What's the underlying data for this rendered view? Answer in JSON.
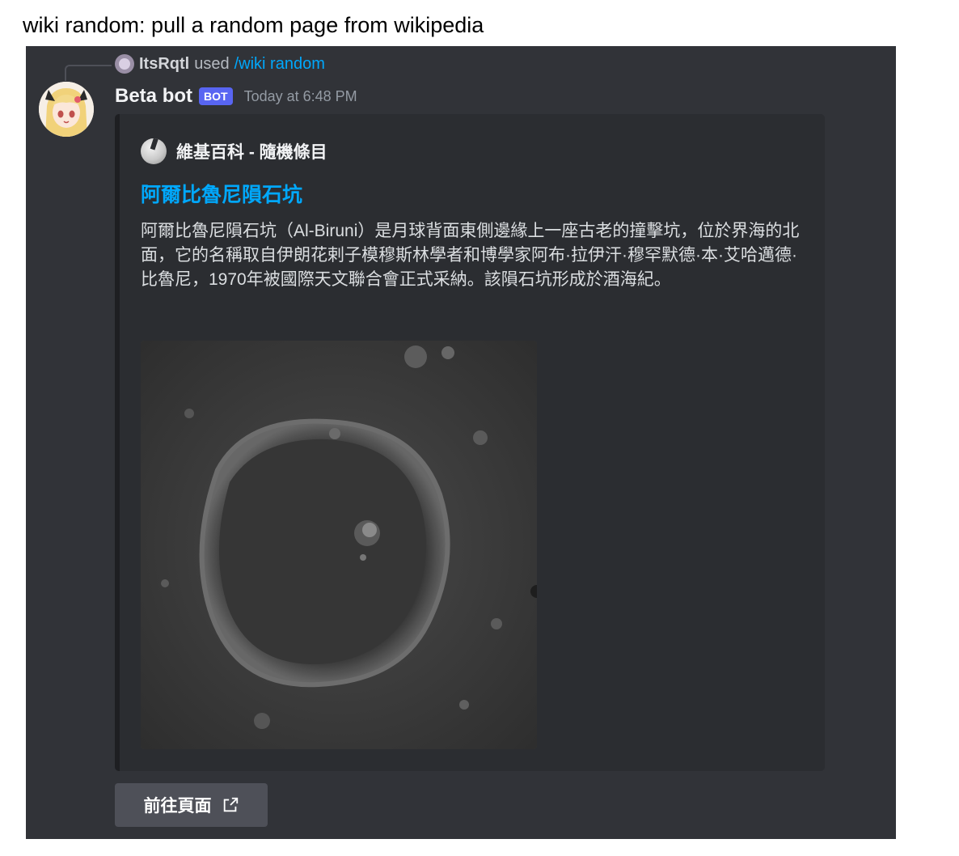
{
  "caption": "wiki random: pull a random page from wikipedia",
  "reply": {
    "user": "ItsRqtl",
    "used": "used",
    "command": "/wiki random"
  },
  "message": {
    "bot_name": "Beta bot",
    "badge": "BOT",
    "timestamp": "Today at 6:48 PM"
  },
  "embed": {
    "author": "維基百科 - 隨機條目",
    "title": "阿爾比魯尼隕石坑",
    "description": "阿爾比魯尼隕石坑（Al-Biruni）是月球背面東側邊緣上一座古老的撞擊坑，位於界海的北面，它的名稱取自伊朗花剌子模穆斯林學者和博學家阿布·拉伊汗·穆罕默德·本·艾哈邁德·比魯尼，1970年被國際天文聯合會正式采納。該隕石坑形成於酒海紀。"
  },
  "button": {
    "label": "前往頁面"
  },
  "colors": {
    "chat_bg": "#313338",
    "embed_bg": "#2b2d31",
    "link": "#00a8fc",
    "badge": "#5865f2",
    "button": "#4e5058"
  },
  "icons": [
    "wikipedia-globe-icon",
    "external-link-icon"
  ]
}
